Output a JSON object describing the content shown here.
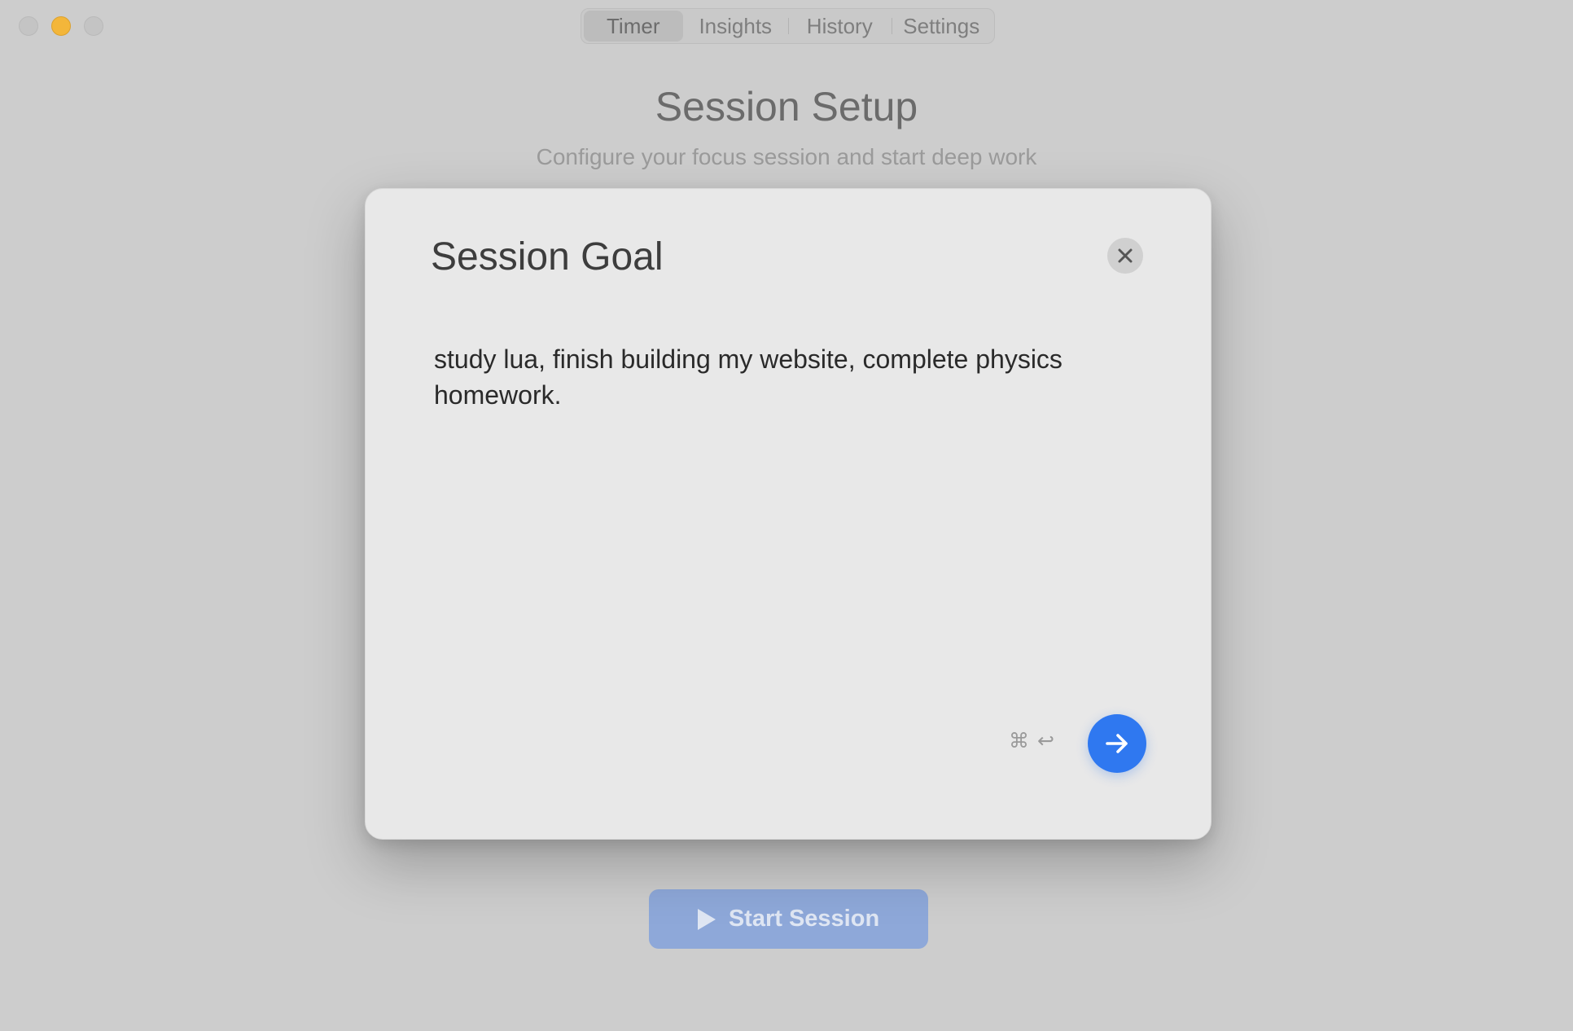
{
  "window": {
    "traffic_lights": [
      "close",
      "minimize",
      "zoom"
    ]
  },
  "tabs": [
    {
      "label": "Timer",
      "active": true
    },
    {
      "label": "Insights",
      "active": false
    },
    {
      "label": "History",
      "active": false
    },
    {
      "label": "Settings",
      "active": false
    }
  ],
  "header": {
    "title": "Session Setup",
    "subtitle": "Configure your focus session and start deep work"
  },
  "modal": {
    "title": "Session Goal",
    "close_icon": "close-icon",
    "goal_text": "study lua, finish building my website, complete physics homework.",
    "shortcut_keys": [
      "⌘",
      "↩"
    ],
    "submit_icon": "arrow-right-icon"
  },
  "start_button": {
    "label": "Start Session",
    "icon": "play-icon"
  },
  "colors": {
    "accent": "#2f78f0",
    "background": "#cdcdcd",
    "modal_bg": "#e8e8e8"
  }
}
